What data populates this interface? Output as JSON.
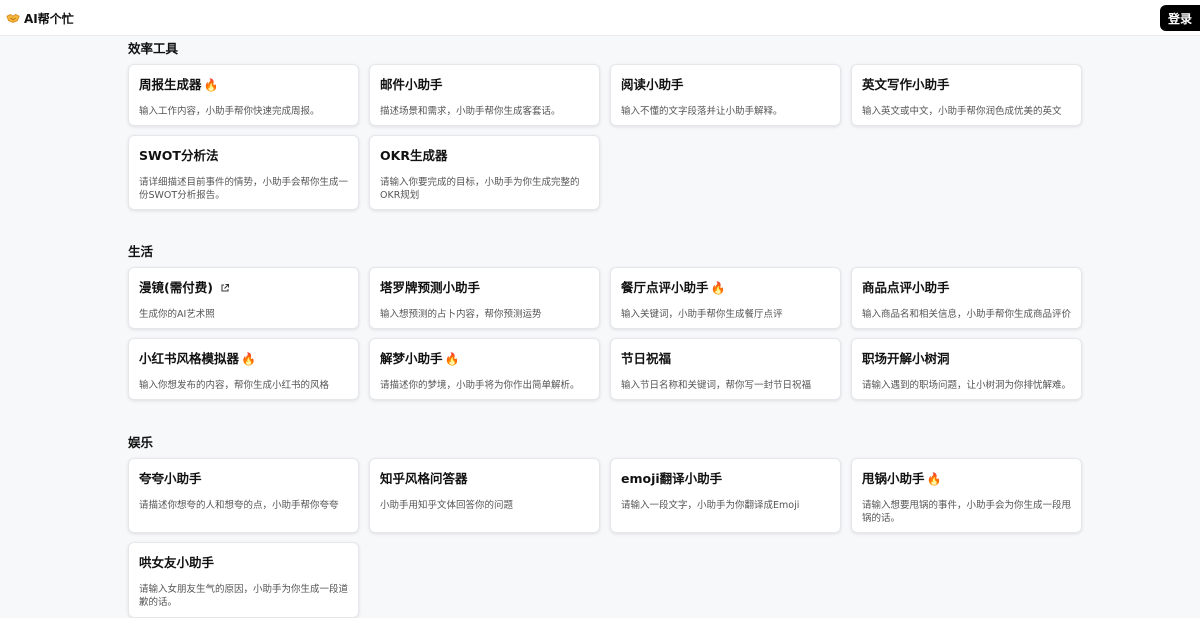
{
  "header": {
    "brand": "AI帮个忙",
    "login_label": "登录"
  },
  "sections": [
    {
      "title": "效率工具",
      "items": [
        {
          "title": "周报生成器",
          "desc": "输入工作内容，小助手帮你快速完成周报。",
          "hot": true
        },
        {
          "title": "邮件小助手",
          "desc": "描述场景和需求，小助手帮你生成客套话。",
          "hot": false
        },
        {
          "title": "阅读小助手",
          "desc": "输入不懂的文字段落并让小助手解释。",
          "hot": false
        },
        {
          "title": "英文写作小助手",
          "desc": "输入英文或中文，小助手帮你润色成优美的英文",
          "hot": false
        },
        {
          "title": "SWOT分析法",
          "desc": "请详细描述目前事件的情势，小助手会帮你生成一份SWOT分析报告。",
          "hot": false
        },
        {
          "title": "OKR生成器",
          "desc": "请输入你要完成的目标，小助手为你生成完整的OKR规划",
          "hot": false
        }
      ]
    },
    {
      "title": "生活",
      "items": [
        {
          "title": "漫镜(需付费)",
          "desc": "生成你的AI艺术照",
          "hot": false,
          "external": true
        },
        {
          "title": "塔罗牌预测小助手",
          "desc": "输入想预测的占卜内容，帮你预测运势",
          "hot": false
        },
        {
          "title": "餐厅点评小助手",
          "desc": "输入关键词，小助手帮你生成餐厅点评",
          "hot": true
        },
        {
          "title": "商品点评小助手",
          "desc": "输入商品名和相关信息，小助手帮你生成商品评价",
          "hot": false
        },
        {
          "title": "小红书风格模拟器",
          "desc": "输入你想发布的内容，帮你生成小红书的风格",
          "hot": true
        },
        {
          "title": "解梦小助手",
          "desc": "请描述你的梦境，小助手将为你作出简单解析。",
          "hot": true
        },
        {
          "title": "节日祝福",
          "desc": "输入节日名称和关键词，帮你写一封节日祝福",
          "hot": false
        },
        {
          "title": "职场开解小树洞",
          "desc": "请输入遇到的职场问题，让小树洞为你排忧解难。",
          "hot": false
        }
      ]
    },
    {
      "title": "娱乐",
      "items": [
        {
          "title": "夸夸小助手",
          "desc": "请描述你想夸的人和想夸的点，小助手帮你夸夸",
          "hot": false
        },
        {
          "title": "知乎风格问答器",
          "desc": "小助手用知乎文体回答你的问题",
          "hot": false
        },
        {
          "title": "emoji翻译小助手",
          "desc": "请输入一段文字，小助手为你翻译成Emoji",
          "hot": false
        },
        {
          "title": "甩锅小助手",
          "desc": "请输入想要甩锅的事件，小助手会为你生成一段甩锅的话。",
          "hot": true
        },
        {
          "title": "哄女友小助手",
          "desc": "请输入女朋友生气的原因，小助手为你生成一段道歉的话。",
          "hot": false
        }
      ]
    }
  ],
  "icons": {
    "fire": "fire-icon",
    "external": "external-link-icon",
    "brand": "handshake-icon"
  },
  "colors": {
    "login_bg": "#000000",
    "fire": "#f97316",
    "page_bg": "#f7f8fa"
  }
}
